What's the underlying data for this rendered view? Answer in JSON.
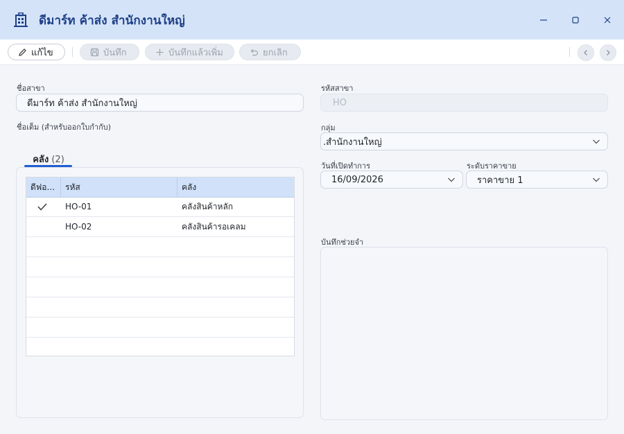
{
  "window": {
    "title": "ดีมาร์ท ค้าส่ง สำนักงานใหญ่",
    "icon": "building-icon"
  },
  "toolbar": {
    "edit_label": "แก้ไข",
    "save_label": "บันทึก",
    "save_new_label": "บันทึกแล้วเพิ่ม",
    "cancel_label": "ยกเลิก"
  },
  "form": {
    "branch_name": {
      "label": "ชื่อสาขา",
      "value": "ดีมาร์ท ค้าส่ง สำนักงานใหญ่"
    },
    "full_name": {
      "label": "ชื่อเต็ม (สำหรับออกใบกำกับ)",
      "value": ""
    },
    "branch_code": {
      "label": "รหัสสาขา",
      "value": "HO"
    },
    "group": {
      "label": "กลุ่ม",
      "value": ".สำนักงานใหญ่"
    },
    "open_date": {
      "label": "วันที่เปิดทำการ",
      "value": "16/09/2026"
    },
    "price_level": {
      "label": "ระดับราคาขาย",
      "value": "ราคาขาย 1"
    },
    "memo": {
      "label": "บันทึกช่วยจำ",
      "value": ""
    }
  },
  "tabs": [
    {
      "label": "คลัง",
      "count": "(2)"
    }
  ],
  "warehouse_grid": {
    "columns": [
      "ดีฟอ...",
      "รหัส",
      "คลัง"
    ],
    "rows": [
      {
        "default": true,
        "code": "HO-01",
        "name": "คลังสินค้าหลัก"
      },
      {
        "default": false,
        "code": "HO-02",
        "name": "คลังสินค้ารอเคลม"
      }
    ]
  },
  "colors": {
    "titlebar_bg": "#d4e3f8",
    "title_text": "#1d3f86",
    "accent": "#1f5fd1",
    "grid_header_bg": "#d0e1f9"
  }
}
